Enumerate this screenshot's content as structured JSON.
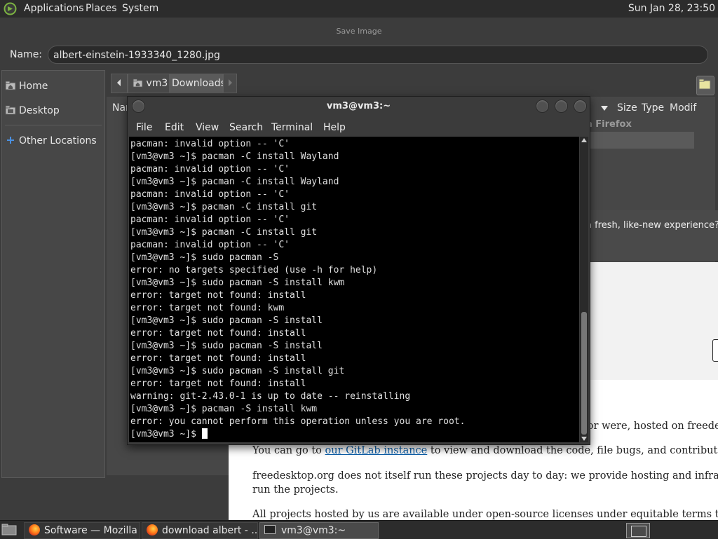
{
  "panel": {
    "menus": [
      "Applications",
      "Places",
      "System"
    ],
    "clock": "Sun Jan 28, 23:50"
  },
  "dialog": {
    "title": "Save Image",
    "name_label": "Name:",
    "name_value": "albert-einstein-1933340_1280.jpg",
    "sidebar": [
      "Home",
      "Desktop",
      "Other Locations"
    ],
    "path": [
      "vm3",
      "Downloads"
    ],
    "columns": [
      "Nar",
      "Size",
      "Type",
      "Modif"
    ]
  },
  "firefox": {
    "tab_fragment": "a Firefox",
    "banner_fragment": "a fresh, like-new experience? Ar",
    "p0_fragment": "e, or were, hosted on freedes",
    "p1_pre": "You can go to ",
    "p1_link": "our GitLab instance",
    "p1_post": " to view and download the code, file bugs, and contribute code throug",
    "p2_line1": "freedesktop.org does not itself run these projects day to day: we provide hosting and infrastructure for th",
    "p2_line2": "run the projects.",
    "p3": "All projects hosted by us are available under open-source licenses under equitable terms to all parties. T"
  },
  "terminal": {
    "title": "vm3@vm3:~",
    "menus": [
      "File",
      "Edit",
      "View",
      "Search",
      "Terminal",
      "Help"
    ],
    "lines": [
      "pacman: invalid option -- 'C'",
      "[vm3@vm3 ~]$ pacman -C install Wayland",
      "pacman: invalid option -- 'C'",
      "[vm3@vm3 ~]$ pacman -C install Wayland",
      "pacman: invalid option -- 'C'",
      "[vm3@vm3 ~]$ pacman -C install git",
      "pacman: invalid option -- 'C'",
      "[vm3@vm3 ~]$ pacman -C install git",
      "pacman: invalid option -- 'C'",
      "[vm3@vm3 ~]$ sudo pacman -S",
      "error: no targets specified (use -h for help)",
      "[vm3@vm3 ~]$ sudo pacman -S install kwm",
      "error: target not found: install",
      "error: target not found: kwm",
      "[vm3@vm3 ~]$ sudo pacman -S install",
      "error: target not found: install",
      "[vm3@vm3 ~]$ sudo pacman -S install",
      "error: target not found: install",
      "[vm3@vm3 ~]$ sudo pacman -S install git",
      "error: target not found: install",
      "warning: git-2.43.0-1 is up to date -- reinstalling",
      "[vm3@vm3 ~]$ pacman -S install kwm",
      "error: you cannot perform this operation unless you are root.",
      "[vm3@vm3 ~]$ "
    ]
  },
  "taskbar": {
    "tasks": [
      "Software — Mozilla ...",
      "download albert - ...",
      "vm3@vm3:~"
    ]
  }
}
